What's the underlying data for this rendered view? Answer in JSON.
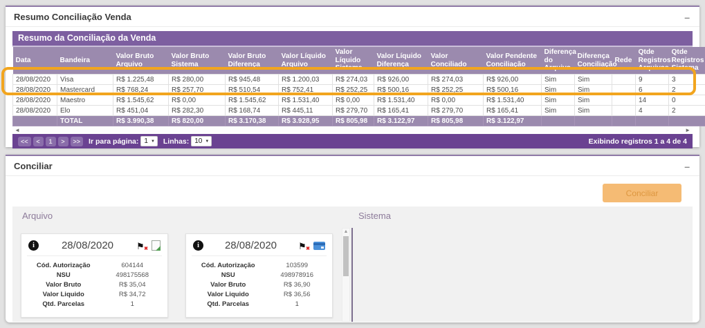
{
  "icons": {
    "minimize": "–",
    "left_arrow": "◄",
    "right_arrow": "►",
    "up_arrow": "▲",
    "info": "i",
    "flag": "⚑",
    "flag_mark": "✖",
    "caret_down": "▼"
  },
  "colors": {
    "accent_purple": "#7d5fa0",
    "muted_purple_header": "#9b8aae",
    "pagination_purple": "#6a4291",
    "highlight_orange": "#f2a51e",
    "button_orange": "#f5bb74"
  },
  "panel_resumo": {
    "title": "Resumo Conciliação Venda",
    "table": {
      "title": "Resumo da Conciliação da Venda",
      "columns": [
        "Data",
        "Bandeira",
        "Valor Bruto Arquivo",
        "Valor Bruto Sistema",
        "Valor Bruto Diferença",
        "Valor Líquido Arquivo",
        "Valor Líquido Sistema",
        "Valor Líquido Diferença",
        "Valor Conciliado",
        "Valor Pendente Conciliação",
        "Diferença do Arquivo",
        "Diferença Conciliação",
        "Rede",
        "Qtde Registros Arquivos",
        "Qtde Registros Sistema"
      ],
      "rows": [
        [
          "28/08/2020",
          "Visa",
          "R$ 1.225,48",
          "R$ 280,00",
          "R$ 945,48",
          "R$ 1.200,03",
          "R$ 274,03",
          "R$ 926,00",
          "R$ 274,03",
          "R$ 926,00",
          "Sim",
          "Sim",
          "",
          "9",
          "3"
        ],
        [
          "28/08/2020",
          "Mastercard",
          "R$ 768,24",
          "R$ 257,70",
          "R$ 510,54",
          "R$ 752,41",
          "R$ 252,25",
          "R$ 500,16",
          "R$ 252,25",
          "R$ 500,16",
          "Sim",
          "Sim",
          "",
          "6",
          "2"
        ],
        [
          "28/08/2020",
          "Maestro",
          "R$ 1.545,62",
          "R$ 0,00",
          "R$ 1.545,62",
          "R$ 1.531,40",
          "R$ 0,00",
          "R$ 1.531,40",
          "R$ 0,00",
          "R$ 1.531,40",
          "Sim",
          "Sim",
          "",
          "14",
          "0"
        ],
        [
          "28/08/2020",
          "Elo",
          "R$ 451,04",
          "R$ 282,30",
          "R$ 168,74",
          "R$ 445,11",
          "R$ 279,70",
          "R$ 165,41",
          "R$ 279,70",
          "R$ 165,41",
          "Sim",
          "Sim",
          "",
          "4",
          "2"
        ]
      ],
      "total_row": [
        "",
        "TOTAL",
        "R$ 3.990,38",
        "R$ 820,00",
        "R$ 3.170,38",
        "R$ 3.928,95",
        "R$ 805,98",
        "R$ 3.122,97",
        "R$ 805,98",
        "R$ 3.122,97",
        "",
        "",
        "",
        "",
        ""
      ]
    },
    "pagination": {
      "first": "<<",
      "prev": "<",
      "page": "1",
      "next": ">",
      "last": ">>",
      "goto_label": "Ir para página:",
      "goto_value": "1",
      "lines_label": "Linhas:",
      "lines_value": "10",
      "status": "Exibindo registros 1 a 4 de 4"
    }
  },
  "panel_conciliar": {
    "title": "Conciliar",
    "button_label": "Conciliar",
    "arquivo_label": "Arquivo",
    "sistema_label": "Sistema",
    "cards": [
      {
        "date": "28/08/2020",
        "fields": [
          [
            "Cód. Autorização",
            "604144"
          ],
          [
            "NSU",
            "498175568"
          ],
          [
            "Valor Bruto",
            "R$ 35,04"
          ],
          [
            "Valor Liquido",
            "R$ 34,72"
          ],
          [
            "Qtd. Parcelas",
            "1"
          ]
        ]
      },
      {
        "date": "28/08/2020",
        "fields": [
          [
            "Cód. Autorização",
            "103599"
          ],
          [
            "NSU",
            "498978916"
          ],
          [
            "Valor Bruto",
            "R$ 36,90"
          ],
          [
            "Valor Liquido",
            "R$ 36,56"
          ],
          [
            "Qtd. Parcelas",
            "1"
          ]
        ]
      }
    ]
  }
}
